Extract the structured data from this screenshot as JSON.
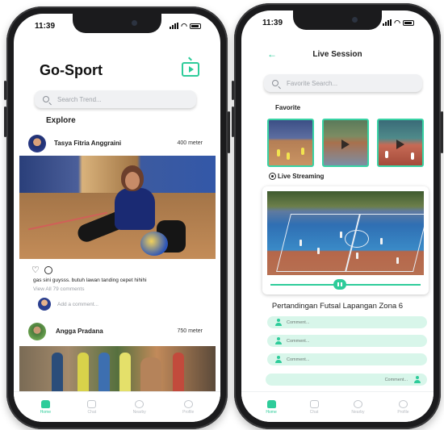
{
  "left_phone": {
    "status": {
      "time": "11:39"
    },
    "app_title": "Go-Sport",
    "search": {
      "placeholder": "Search Trend..."
    },
    "section_title": "Explore",
    "posts": [
      {
        "user": "Tasya Fitria Anggraini",
        "distance": "400 meter",
        "caption": "gas sini guysss. butuh lawan tanding cepet hihihi",
        "view_all": "View All 79 comments",
        "add_comment": "Add a comment..."
      },
      {
        "user": "Angga Pradana",
        "distance": "750 meter"
      }
    ],
    "tabbar": [
      "Home",
      "Chat",
      "Nearby",
      "Profile"
    ]
  },
  "right_phone": {
    "status": {
      "time": "11:39"
    },
    "screen_title": "Live Session",
    "search": {
      "placeholder": "Favorite Search..."
    },
    "favorite_label": "Favorite",
    "live_label": "Live Streaming",
    "match_title": "Pertandingan Futsal Lapangan Zona 6",
    "comments": [
      "Comment...",
      "Comment...",
      "Comment..."
    ],
    "my_comment": "Comment...",
    "tabbar": [
      "Home",
      "Chat",
      "Nearby",
      "Profile"
    ]
  },
  "colors": {
    "accent": "#2ecc9a",
    "accent_light": "#d8f6ea"
  },
  "icons": [
    "back-arrow-icon",
    "tv-play-icon",
    "search-icon",
    "heart-icon",
    "chat-bubble-icon",
    "broadcast-icon",
    "user-icon",
    "home-icon",
    "nearby-pin-icon",
    "profile-icon"
  ]
}
